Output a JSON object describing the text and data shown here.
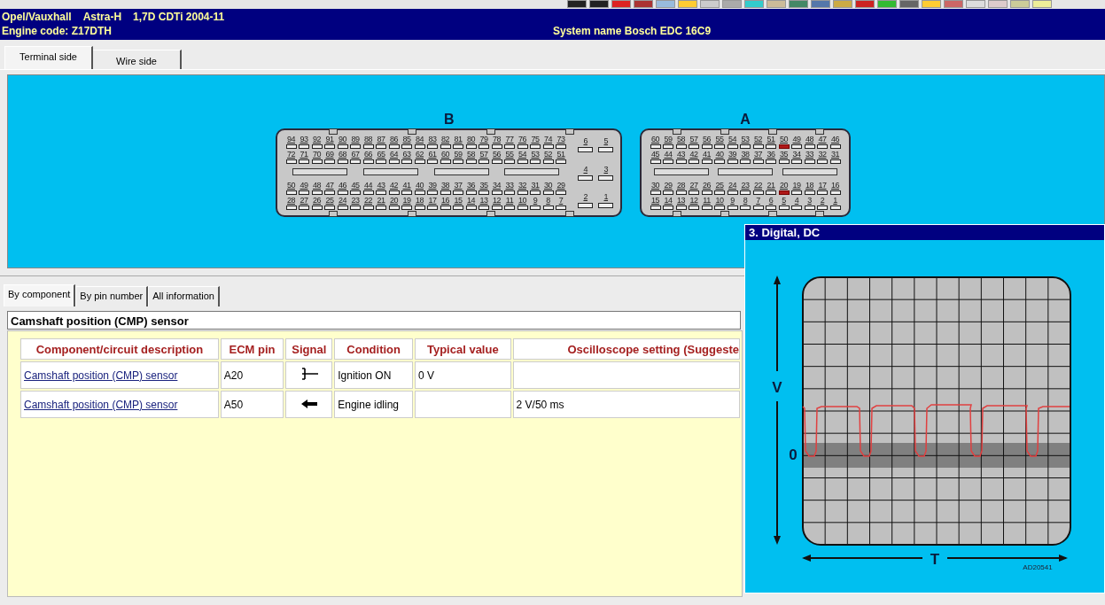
{
  "header": {
    "make": "Opel/Vauxhall",
    "model": "Astra-H",
    "engine": "1,7D CDTi 2004-11",
    "engine_code": "Engine code: Z17DTH",
    "system": "System name Bosch EDC 16C9"
  },
  "view_tabs": [
    {
      "label": "Terminal side",
      "selected": true
    },
    {
      "label": "Wire side",
      "selected": false
    }
  ],
  "connectors": [
    {
      "label": "B",
      "main_rows": [
        [
          {
            "n": "94",
            "highlighted": false
          },
          {
            "n": "93",
            "highlighted": false
          },
          {
            "n": "92",
            "highlighted": false
          },
          {
            "n": "91",
            "highlighted": false
          },
          {
            "n": "90",
            "highlighted": false
          },
          {
            "n": "89",
            "highlighted": false
          },
          {
            "n": "88",
            "highlighted": false
          },
          {
            "n": "87",
            "highlighted": false
          },
          {
            "n": "86",
            "highlighted": false
          },
          {
            "n": "85",
            "highlighted": false
          },
          {
            "n": "84",
            "highlighted": false
          },
          {
            "n": "83",
            "highlighted": false
          },
          {
            "n": "82",
            "highlighted": false
          },
          {
            "n": "81",
            "highlighted": false
          },
          {
            "n": "80",
            "highlighted": false
          },
          {
            "n": "79",
            "highlighted": false
          },
          {
            "n": "78",
            "highlighted": false
          },
          {
            "n": "77",
            "highlighted": false
          },
          {
            "n": "76",
            "highlighted": false
          },
          {
            "n": "75",
            "highlighted": false
          },
          {
            "n": "74",
            "highlighted": false
          },
          {
            "n": "73",
            "highlighted": false
          }
        ],
        [
          {
            "n": "72",
            "highlighted": false
          },
          {
            "n": "71",
            "highlighted": false
          },
          {
            "n": "70",
            "highlighted": false
          },
          {
            "n": "69",
            "highlighted": false
          },
          {
            "n": "68",
            "highlighted": false
          },
          {
            "n": "67",
            "highlighted": false
          },
          {
            "n": "66",
            "highlighted": false
          },
          {
            "n": "65",
            "highlighted": false
          },
          {
            "n": "64",
            "highlighted": false
          },
          {
            "n": "63",
            "highlighted": false
          },
          {
            "n": "62",
            "highlighted": false
          },
          {
            "n": "61",
            "highlighted": false
          },
          {
            "n": "60",
            "highlighted": false
          },
          {
            "n": "59",
            "highlighted": false
          },
          {
            "n": "58",
            "highlighted": false
          },
          {
            "n": "57",
            "highlighted": false
          },
          {
            "n": "56",
            "highlighted": false
          },
          {
            "n": "55",
            "highlighted": false
          },
          {
            "n": "54",
            "highlighted": false
          },
          {
            "n": "53",
            "highlighted": false
          },
          {
            "n": "52",
            "highlighted": false
          },
          {
            "n": "51",
            "highlighted": false
          }
        ],
        [
          {
            "n": "50",
            "highlighted": false
          },
          {
            "n": "49",
            "highlighted": false
          },
          {
            "n": "48",
            "highlighted": false
          },
          {
            "n": "47",
            "highlighted": false
          },
          {
            "n": "46",
            "highlighted": false
          },
          {
            "n": "45",
            "highlighted": false
          },
          {
            "n": "44",
            "highlighted": false
          },
          {
            "n": "43",
            "highlighted": false
          },
          {
            "n": "42",
            "highlighted": false
          },
          {
            "n": "41",
            "highlighted": false
          },
          {
            "n": "40",
            "highlighted": false
          },
          {
            "n": "39",
            "highlighted": false
          },
          {
            "n": "38",
            "highlighted": false
          },
          {
            "n": "37",
            "highlighted": false
          },
          {
            "n": "36",
            "highlighted": false
          },
          {
            "n": "35",
            "highlighted": false
          },
          {
            "n": "34",
            "highlighted": false
          },
          {
            "n": "33",
            "highlighted": false
          },
          {
            "n": "32",
            "highlighted": false
          },
          {
            "n": "31",
            "highlighted": false
          },
          {
            "n": "30",
            "highlighted": false
          },
          {
            "n": "29",
            "highlighted": false
          }
        ],
        [
          {
            "n": "28",
            "highlighted": false
          },
          {
            "n": "27",
            "highlighted": false
          },
          {
            "n": "26",
            "highlighted": false
          },
          {
            "n": "25",
            "highlighted": false
          },
          {
            "n": "24",
            "highlighted": false
          },
          {
            "n": "23",
            "highlighted": false
          },
          {
            "n": "22",
            "highlighted": false
          },
          {
            "n": "21",
            "highlighted": false
          },
          {
            "n": "20",
            "highlighted": false
          },
          {
            "n": "19",
            "highlighted": false
          },
          {
            "n": "18",
            "highlighted": false
          },
          {
            "n": "17",
            "highlighted": false
          },
          {
            "n": "16",
            "highlighted": false
          },
          {
            "n": "15",
            "highlighted": false
          },
          {
            "n": "14",
            "highlighted": false
          },
          {
            "n": "13",
            "highlighted": false
          },
          {
            "n": "12",
            "highlighted": false
          },
          {
            "n": "11",
            "highlighted": false
          },
          {
            "n": "10",
            "highlighted": false
          },
          {
            "n": "9",
            "highlighted": false
          },
          {
            "n": "8",
            "highlighted": false
          },
          {
            "n": "7",
            "highlighted": false
          }
        ]
      ],
      "side_rows": [
        [
          {
            "n": "6",
            "highlighted": false
          },
          {
            "n": "5",
            "highlighted": false
          }
        ],
        [
          {
            "n": "4",
            "highlighted": false
          },
          {
            "n": "3",
            "highlighted": false
          }
        ],
        [
          {
            "n": "2",
            "highlighted": false
          },
          {
            "n": "1",
            "highlighted": false
          }
        ]
      ]
    },
    {
      "label": "A",
      "main_rows": [
        [
          {
            "n": "60",
            "highlighted": false
          },
          {
            "n": "59",
            "highlighted": false
          },
          {
            "n": "58",
            "highlighted": false
          },
          {
            "n": "57",
            "highlighted": false
          },
          {
            "n": "56",
            "highlighted": false
          },
          {
            "n": "55",
            "highlighted": false
          },
          {
            "n": "54",
            "highlighted": false
          },
          {
            "n": "53",
            "highlighted": false
          },
          {
            "n": "52",
            "highlighted": false
          },
          {
            "n": "51",
            "highlighted": false
          },
          {
            "n": "50",
            "highlighted": true
          },
          {
            "n": "49",
            "highlighted": false
          },
          {
            "n": "48",
            "highlighted": false
          },
          {
            "n": "47",
            "highlighted": false
          },
          {
            "n": "46",
            "highlighted": false
          }
        ],
        [
          {
            "n": "45",
            "highlighted": false
          },
          {
            "n": "44",
            "highlighted": false
          },
          {
            "n": "43",
            "highlighted": false
          },
          {
            "n": "42",
            "highlighted": false
          },
          {
            "n": "41",
            "highlighted": false
          },
          {
            "n": "40",
            "highlighted": false
          },
          {
            "n": "39",
            "highlighted": false
          },
          {
            "n": "38",
            "highlighted": false
          },
          {
            "n": "37",
            "highlighted": false
          },
          {
            "n": "36",
            "highlighted": false
          },
          {
            "n": "35",
            "highlighted": false
          },
          {
            "n": "34",
            "highlighted": false
          },
          {
            "n": "33",
            "highlighted": false
          },
          {
            "n": "32",
            "highlighted": false
          },
          {
            "n": "31",
            "highlighted": false
          }
        ],
        [
          {
            "n": "30",
            "highlighted": false
          },
          {
            "n": "29",
            "highlighted": false
          },
          {
            "n": "28",
            "highlighted": false
          },
          {
            "n": "27",
            "highlighted": false
          },
          {
            "n": "26",
            "highlighted": false
          },
          {
            "n": "25",
            "highlighted": false
          },
          {
            "n": "24",
            "highlighted": false
          },
          {
            "n": "23",
            "highlighted": false
          },
          {
            "n": "22",
            "highlighted": false
          },
          {
            "n": "21",
            "highlighted": false
          },
          {
            "n": "20",
            "highlighted": true
          },
          {
            "n": "19",
            "highlighted": false
          },
          {
            "n": "18",
            "highlighted": false
          },
          {
            "n": "17",
            "highlighted": false
          },
          {
            "n": "16",
            "highlighted": false
          }
        ],
        [
          {
            "n": "15",
            "highlighted": false
          },
          {
            "n": "14",
            "highlighted": false
          },
          {
            "n": "13",
            "highlighted": false
          },
          {
            "n": "12",
            "highlighted": false
          },
          {
            "n": "11",
            "highlighted": false
          },
          {
            "n": "10",
            "highlighted": false
          },
          {
            "n": "9",
            "highlighted": false
          },
          {
            "n": "8",
            "highlighted": false
          },
          {
            "n": "7",
            "highlighted": false
          },
          {
            "n": "6",
            "highlighted": false
          },
          {
            "n": "5",
            "highlighted": false
          },
          {
            "n": "4",
            "highlighted": false
          },
          {
            "n": "3",
            "highlighted": false
          },
          {
            "n": "2",
            "highlighted": false
          },
          {
            "n": "1",
            "highlighted": false
          }
        ]
      ]
    }
  ],
  "info_tabs": [
    {
      "label": "By component",
      "selected": true
    },
    {
      "label": "By pin number",
      "selected": false
    },
    {
      "label": "All information",
      "selected": false
    }
  ],
  "component_title": "Camshaft position (CMP) sensor",
  "table": {
    "columns": [
      "Component/circuit description",
      "ECM pin",
      "Signal",
      "Condition",
      "Typical value",
      "Oscilloscope setting (Suggeste"
    ],
    "rows": [
      {
        "description": "Camshaft position (CMP) sensor",
        "pin": "A20",
        "signal": {
          "kind": "sensor"
        },
        "condition": "Ignition ON",
        "typical": "0 V"
      },
      {
        "description": "Camshaft position (CMP) sensor",
        "pin": "A50",
        "signal": {
          "kind": "arrow"
        },
        "condition": "Engine idling",
        "scope": "2 V/50 ms"
      }
    ]
  },
  "scope": {
    "title": "3. Digital, DC",
    "v_label": "V",
    "zero_label": "0",
    "t_label": "T",
    "reference": "AD20541"
  }
}
